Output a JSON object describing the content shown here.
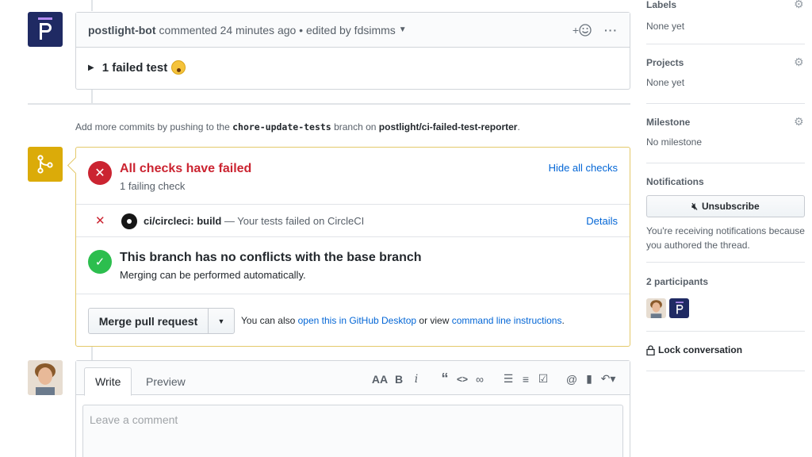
{
  "comment": {
    "author": "postlight-bot",
    "meta": "commented 24 minutes ago • edited by fdsimms",
    "reaction_label": "+",
    "more_label": "···",
    "body": "1 failed test"
  },
  "push_note": {
    "prefix": "Add more commits by pushing to the",
    "branch": "chore-update-tests",
    "middle": "branch on",
    "repo": "postlight/ci-failed-test-reporter",
    "suffix": "."
  },
  "checks": {
    "title": "All checks have failed",
    "subtitle": "1 failing check",
    "hide_link": "Hide all checks",
    "row": {
      "name": "ci/circleci: build",
      "description": "— Your tests failed on CircleCI",
      "details_link": "Details"
    }
  },
  "conflicts": {
    "title": "This branch has no conflicts with the base branch",
    "subtitle": "Merging can be performed automatically."
  },
  "merge": {
    "button": "Merge pull request",
    "also_prefix": "You can also",
    "desktop_link": "open this in GitHub Desktop",
    "or_view": "or view",
    "cli_link": "command line instructions",
    "suffix": "."
  },
  "form": {
    "tab_write": "Write",
    "tab_preview": "Preview",
    "placeholder": "Leave a comment"
  },
  "sidebar": {
    "labels": {
      "heading": "Labels",
      "value": "None yet"
    },
    "projects": {
      "heading": "Projects",
      "value": "None yet"
    },
    "milestone": {
      "heading": "Milestone",
      "value": "No milestone"
    },
    "notifications": {
      "heading": "Notifications",
      "button": "Unsubscribe",
      "text": "You're receiving notifications because you authored the thread."
    },
    "participants": {
      "heading": "2 participants"
    },
    "lock": {
      "label": "Lock conversation"
    }
  },
  "colors": {
    "fail": "#cb2431",
    "success": "#2cbe4e",
    "merge_accent": "#dbab09",
    "link": "#0366d6",
    "bot_avatar": "#1f2a63"
  },
  "icons": {
    "bot_avatar": "postlight-logo-icon",
    "merge_state": "git-merge-icon",
    "fail": "x-icon",
    "success": "check-icon",
    "ci_logo": "circleci-icon",
    "settings": "gear-icon",
    "mute": "mute-icon",
    "lock": "lock-icon"
  }
}
